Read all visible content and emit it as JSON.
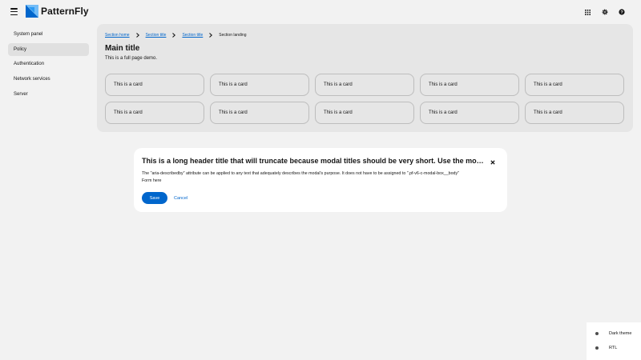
{
  "masthead": {
    "logo_text": "PatternFly",
    "icons": [
      "menu-icon",
      "grid-icon",
      "gear-icon",
      "help-icon"
    ],
    "logo_colors": {
      "primary": "#0066cc",
      "secondary": "#73bcf7"
    }
  },
  "sidebar": {
    "items": [
      {
        "label": "System panel",
        "active": false
      },
      {
        "label": "Policy",
        "active": true
      },
      {
        "label": "Authentication",
        "active": false
      },
      {
        "label": "Network services",
        "active": false
      },
      {
        "label": "Server",
        "active": false
      }
    ]
  },
  "breadcrumb": {
    "items": [
      {
        "label": "Section home",
        "link": true
      },
      {
        "label": "Section title",
        "link": true
      },
      {
        "label": "Section title",
        "link": true
      },
      {
        "label": "Section landing",
        "link": false
      }
    ]
  },
  "main": {
    "title": "Main title",
    "description": "This is a full page demo.",
    "cards": [
      "This is a card",
      "This is a card",
      "This is a card",
      "This is a card",
      "This is a card",
      "This is a card",
      "This is a card",
      "This is a card",
      "This is a card",
      "This is a card"
    ]
  },
  "modal": {
    "title": "This is a long header title that will truncate because modal titles should be very short. Use the modal body to provide more info.",
    "body_line1": "The \"aria-describedby\" attribute can be applied to any text that adequately describes the modal's purpose. It does not have to be assigned to \".pf-v6-c-modal-box__body\"",
    "body_line2": "Form here",
    "save_label": "Save",
    "cancel_label": "Cancel"
  },
  "toggles": {
    "dark_theme_label": "Dark theme",
    "rtl_label": "RTL",
    "dark_theme_on": false,
    "rtl_on": false
  },
  "colors": {
    "accent": "#0066cc",
    "page_bg": "#f2f2f2",
    "main_bg": "#e6e6e6",
    "active_nav_bg": "#e0e0e0"
  }
}
